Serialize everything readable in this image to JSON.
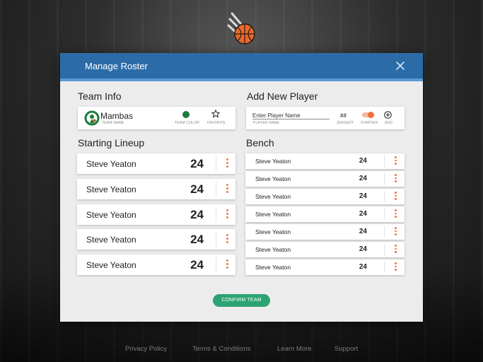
{
  "modal": {
    "title": "Manage Roster"
  },
  "team_info": {
    "heading": "Team Info",
    "team_name": "Mambas",
    "team_name_caption": "TEAM NAME",
    "team_color_caption": "TEAM COLOR",
    "team_color": "#1b7a3e",
    "favorite_caption": "FAVORITE"
  },
  "add_player": {
    "heading": "Add New Player",
    "name_placeholder": "Enter Player Name",
    "name_caption": "PLAYER NAME",
    "jersey_symbol": "##",
    "jersey_caption": "JERSERY",
    "starter_caption": "STARTER",
    "starter_on": true,
    "add_caption": "ADD"
  },
  "starting_lineup": {
    "heading": "Starting Lineup",
    "players": [
      {
        "name": "Steve Yeaton",
        "number": "24"
      },
      {
        "name": "Steve Yeaton",
        "number": "24"
      },
      {
        "name": "Steve Yeaton",
        "number": "24"
      },
      {
        "name": "Steve Yeaton",
        "number": "24"
      },
      {
        "name": "Steve Yeaton",
        "number": "24"
      }
    ]
  },
  "bench": {
    "heading": "Bench",
    "players": [
      {
        "name": "Steve Yeaton",
        "number": "24"
      },
      {
        "name": "Steve Yeaton",
        "number": "24"
      },
      {
        "name": "Steve Yeaton",
        "number": "24"
      },
      {
        "name": "Steve Yeaton",
        "number": "24"
      },
      {
        "name": "Steve Yeaton",
        "number": "24"
      },
      {
        "name": "Steve Yeaton",
        "number": "24"
      },
      {
        "name": "Steve Yeaton",
        "number": "24"
      }
    ]
  },
  "confirm_label": "CONFIRM TEAM",
  "footer": {
    "links": [
      "Privacy Policy",
      "Terms & Conditions",
      "Learn More",
      "Support"
    ]
  },
  "colors": {
    "header": "#2b6ca8",
    "accent_orange": "#f07a48",
    "confirm_green": "#2da374"
  },
  "icons": {
    "app_logo": "basketball-logo-icon",
    "close": "close-icon",
    "team_logo": "celtics-logo-icon",
    "favorite": "star-icon",
    "add": "plus-circle-icon",
    "more": "kebab-menu-icon"
  }
}
